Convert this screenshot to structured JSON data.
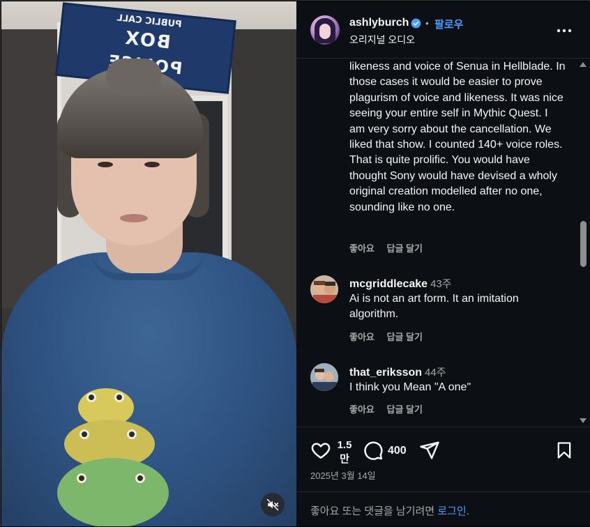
{
  "post": {
    "username": "ashlyburch",
    "separator": "•",
    "follow_label": "팔로우",
    "subtitle": "오리지널 오디오",
    "verified_icon": "verified-badge-icon",
    "accent_color": "#4a9eff"
  },
  "video": {
    "sign_small": "PUBLIC CALL",
    "sign_word1": "POLICE",
    "sign_word2": "BOX",
    "mute_icon": "speaker-muted-icon"
  },
  "comments": [
    {
      "text": "likeness and voice of Senua in Hellblade. In those cases it would be easier to prove plagurism of voice and likeness. It was nice seeing your entire self in Mythic Quest. I am very sorry about the cancellation. We liked that show. I counted 140+ voice roles. That is quite prolific. You would have thought Sony would have devised a wholy original creation modelled after no one, sounding like no one.",
      "like_label": "좋아요",
      "reply_label": "답글 달기"
    },
    {
      "username": "mcgriddlecake",
      "time": "43주",
      "text": "Ai is not an art form. It an imitation algorithm.",
      "like_label": "좋아요",
      "reply_label": "답글 달기"
    },
    {
      "username": "that_eriksson",
      "time": "44주",
      "text": "I think you Mean \"A one\"",
      "like_label": "좋아요",
      "reply_label": "답글 달기"
    }
  ],
  "actions": {
    "like_count_top": "1.5",
    "like_count_bottom": "만",
    "comment_count": "400",
    "date": "2025년 3월 14일"
  },
  "login_prompt": {
    "text": "좋아요 또는 댓글을 남기려면 ",
    "link": "로그인",
    "suffix": "."
  }
}
